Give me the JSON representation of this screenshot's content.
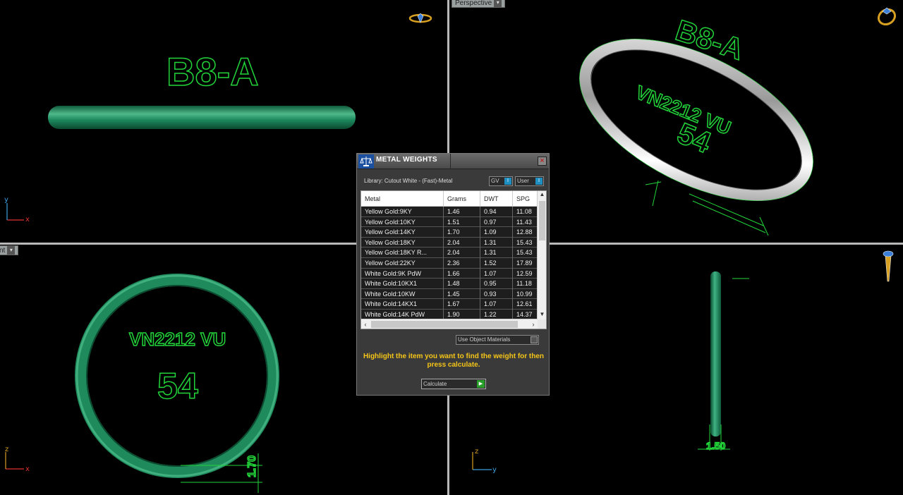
{
  "viewports": {
    "top": {
      "tab_label": "",
      "engraving_text": "B8-A",
      "axis_v": "y",
      "axis_h": "x"
    },
    "perspective": {
      "tab_label": "Perspective",
      "engraving_top": "B8-A",
      "engraving_inner": "VN2212 VU",
      "engraving_size": "54"
    },
    "front": {
      "tab_label": "nt",
      "engraving_inner": "VN2212 VU",
      "engraving_size": "54",
      "dimension": "1.70",
      "axis_v": "z",
      "axis_h": "x"
    },
    "right": {
      "dimension": "1.50",
      "axis_v": "z",
      "axis_h": "y"
    }
  },
  "dialog": {
    "title": "METAL WEIGHTS",
    "close": "×",
    "library_label": "Library: Cutout White - (Fast)-Metal",
    "toggle_gv": "GV",
    "toggle_user": "User",
    "toggle_knob": "I",
    "columns": [
      "Metal",
      "Grams",
      "DWT",
      "SPG"
    ],
    "rows": [
      [
        "Yellow Gold:9KY",
        "1.46",
        "0.94",
        "11.08"
      ],
      [
        "Yellow Gold:10KY",
        "1.51",
        "0.97",
        "11.43"
      ],
      [
        "Yellow Gold:14KY",
        "1.70",
        "1.09",
        "12.88"
      ],
      [
        "Yellow Gold:18KY",
        "2.04",
        "1.31",
        "15.43"
      ],
      [
        "Yellow Gold:18KY R...",
        "2.04",
        "1.31",
        "15.43"
      ],
      [
        "Yellow Gold:22KY",
        "2.36",
        "1.52",
        "17.89"
      ],
      [
        "White Gold:9K PdW",
        "1.66",
        "1.07",
        "12.59"
      ],
      [
        "White Gold:10KX1",
        "1.48",
        "0.95",
        "11.18"
      ],
      [
        "White Gold:10KW",
        "1.45",
        "0.93",
        "10.99"
      ],
      [
        "White Gold:14KX1",
        "1.67",
        "1.07",
        "12.61"
      ],
      [
        "White Gold:14K PdW",
        "1.90",
        "1.22",
        "14.37"
      ]
    ],
    "use_object_materials": "Use Object Materials",
    "hint": "Highlight the item you want to find the weight for then press calculate.",
    "calculate": "Calculate",
    "calculate_icon": "▶"
  },
  "colors": {
    "ring": "#1f8a5c",
    "engraving": "#22d43a",
    "hint": "#f5c518",
    "axis_x": "#e03030",
    "axis_y": "#3aa0e0",
    "axis_z": "#d8a020"
  }
}
